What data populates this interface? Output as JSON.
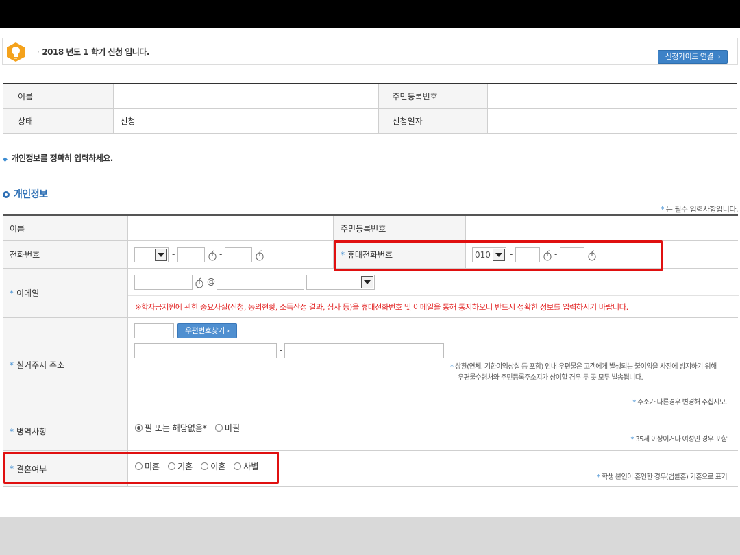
{
  "notice": {
    "text": "2018 년도 1 학기 신청 입니다.",
    "guide_button": "신청가이드 연결"
  },
  "info_table": {
    "name_label": "이름",
    "name_value": "",
    "rrn_label": "주민등록번호",
    "rrn_value": "",
    "status_label": "상태",
    "status_value": "신청",
    "date_label": "신청일자",
    "date_value": ""
  },
  "instruction": "개인정보를 정확히 입력하세요.",
  "section_title": "개인정보",
  "required_note": "는 필수 입력사항입니다.",
  "form": {
    "name_label": "이름",
    "rrn_label": "주민등록번호",
    "phone_label": "전화번호",
    "mobile_label": "휴대전화번호",
    "mobile_prefix": "010",
    "email_label": "이메일",
    "email_at": "@",
    "warning": "※학자금지원에 관한 중요사실(신청, 동의현황, 소득산정 결과, 심사 등)을 휴대전화번호 및 이메일을 통해 통지하오니 반드시 정확한 정보를 입력하시기 바랍니다.",
    "address_label": "실거주지 주소",
    "zip_button": "우편번호찾기",
    "address_note_1": "상환(연체, 기한이익상실 등 포함) 안내 우편물은 고객에게 발생되는 불이익을 사전에 방지하기 위해",
    "address_note_2": "우편물수령처와 주민등록주소지가 상이할 경우 두 곳 모두 발송됩니다.",
    "address_note_3": "주소가 다른경우 변경해 주십시오.",
    "military_label": "병역사항",
    "military_opt1": "필 또는 해당없음*",
    "military_opt2": "미필",
    "military_note": "35세 이상이거나 여성인 경우 포함",
    "marital_label": "결혼여부",
    "marital_opts": [
      "미혼",
      "기혼",
      "이혼",
      "사별"
    ],
    "marital_note": "학생 본인이 혼인한 경우(법률혼) 기혼으로 표기"
  },
  "colors": {
    "accent": "#2d6fb5",
    "warning": "#e32b2b",
    "highlight": "#e01010"
  }
}
